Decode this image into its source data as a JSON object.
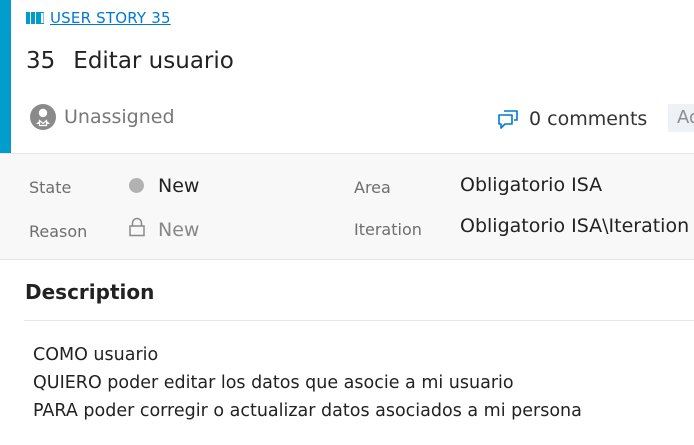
{
  "work_item": {
    "type_label": "USER STORY 35",
    "id": "35",
    "title": "Editar usuario",
    "assigned_to": "Unassigned",
    "comments_label": "0 comments",
    "cutoff_button_label": "Ad"
  },
  "fields": {
    "state": {
      "label": "State",
      "value": "New"
    },
    "reason": {
      "label": "Reason",
      "value": "New"
    },
    "area": {
      "label": "Area",
      "value": "Obligatorio ISA"
    },
    "iteration": {
      "label": "Iteration",
      "value": "Obligatorio ISA\\Iteration"
    }
  },
  "description": {
    "heading": "Description",
    "lines": [
      "COMO usuario",
      "QUIERO poder editar los datos que asocie a mi usuario",
      "PARA poder corregir o actualizar datos asociados a mi persona"
    ]
  },
  "colors": {
    "accent": "#009ccc",
    "link": "#0078d4",
    "state_new": "#b2b2b2"
  },
  "icons": [
    "user-story-book-icon",
    "avatar-icon",
    "comment-icon",
    "state-circle-icon",
    "lock-icon"
  ]
}
